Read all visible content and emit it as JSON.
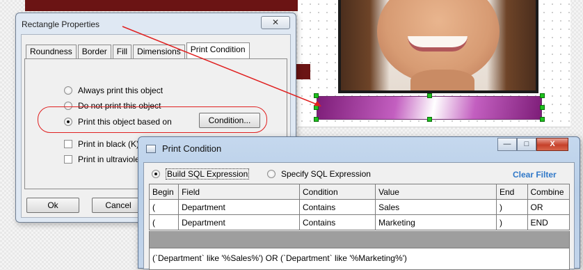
{
  "rectangle_properties": {
    "title": "Rectangle Properties",
    "close_glyph": "✕",
    "tabs": [
      {
        "label": "Roundness",
        "active": false
      },
      {
        "label": "Border",
        "active": false
      },
      {
        "label": "Fill",
        "active": false
      },
      {
        "label": "Dimensions",
        "active": false
      },
      {
        "label": "Print Condition",
        "active": true
      }
    ],
    "options": {
      "always": "Always print this object",
      "never": "Do not print this object",
      "based_on": "Print this object based on",
      "black": "Print in black (K)",
      "ultraviolet": "Print in ultraviolet"
    },
    "selected_option": "based_on",
    "condition_button": "Condition...",
    "ok_button": "Ok",
    "cancel_button": "Cancel"
  },
  "print_condition": {
    "title": "Print Condition",
    "mode_build": "Build SQL Expression",
    "mode_specify": "Specify SQL Expression",
    "selected_mode": "build",
    "clear_filter": "Clear Filter",
    "window_buttons": {
      "minimize": "—",
      "maximize": "□",
      "close": "X"
    },
    "columns": [
      "Begin",
      "Field",
      "Condition",
      "Value",
      "End",
      "Combine"
    ],
    "rows": [
      [
        "(",
        "Department",
        "Contains",
        "Sales",
        ")",
        "OR"
      ],
      [
        "(",
        "Department",
        "Contains",
        "Marketing",
        ")",
        "END"
      ]
    ],
    "expression": "(`Department` like '%Sales%') OR (`Department` like '%Marketing%')"
  },
  "colors": {
    "annotation": "#e02020",
    "accent_link": "#3078c8",
    "gradient_shape": "#a040a0",
    "selection_handle": "#1ec21e"
  }
}
